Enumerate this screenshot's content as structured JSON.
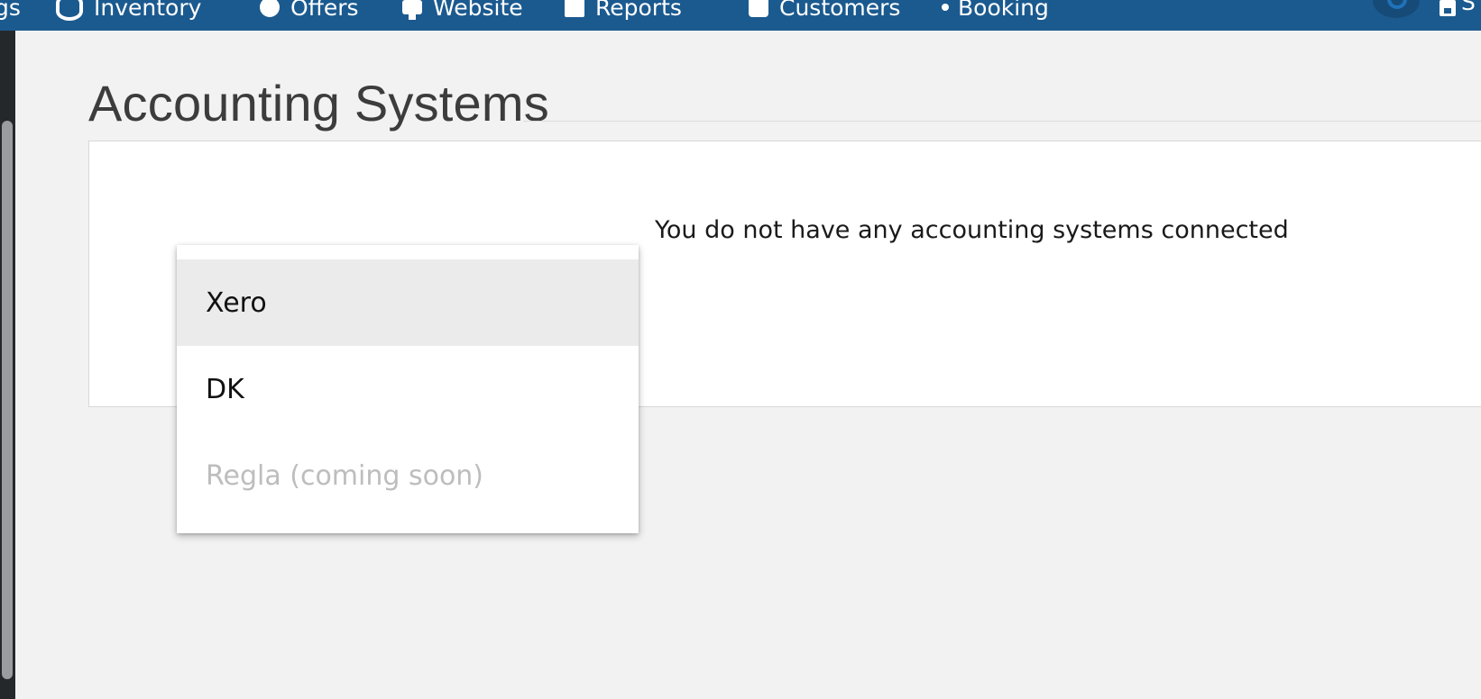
{
  "nav": {
    "items": [
      {
        "label": "gs",
        "icon": ""
      },
      {
        "label": "Inventory",
        "icon": "database-icon"
      },
      {
        "label": "Offers",
        "icon": "gear-icon"
      },
      {
        "label": "Website",
        "icon": "monitor-icon"
      },
      {
        "label": "Reports",
        "icon": "report-icon"
      },
      {
        "label": "Customers",
        "icon": "user-icon"
      },
      {
        "label": "Booking",
        "icon": "dot-icon"
      }
    ],
    "save_label": "S"
  },
  "page": {
    "title": "Accounting Systems",
    "empty_message": "You do not have any accounting systems connected"
  },
  "dropdown": {
    "options": [
      {
        "label": "Xero",
        "state": "highlighted"
      },
      {
        "label": "DK",
        "state": "enabled"
      },
      {
        "label": "Regla (coming soon)",
        "state": "disabled"
      }
    ]
  },
  "colors": {
    "topbar": "#1b5a8f",
    "background": "#f2f2f2",
    "highlight": "#ebebeb",
    "disabled_text": "#bdbdbd"
  }
}
